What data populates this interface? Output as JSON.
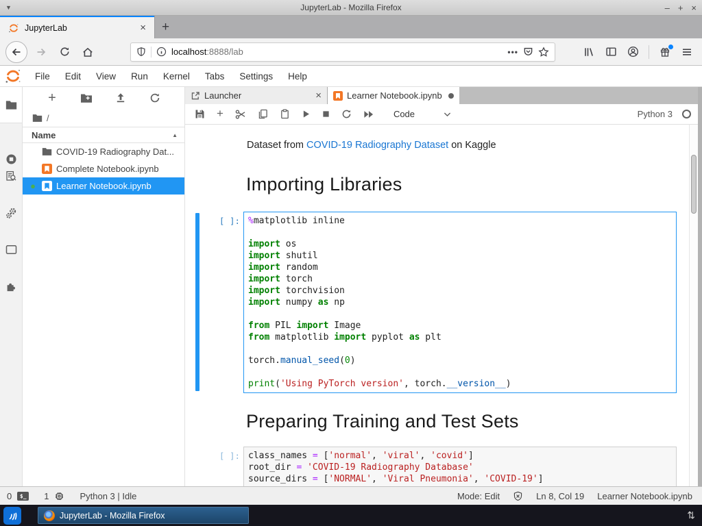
{
  "window": {
    "title": "JupyterLab - Mozilla Firefox",
    "controls": {
      "minimize": "–",
      "maximize": "+",
      "close": "×"
    }
  },
  "browser": {
    "tab_title": "JupyterLab",
    "tab_close": "×",
    "new_tab": "+",
    "url_host": "localhost",
    "url_rest": ":8888/lab"
  },
  "menubar": {
    "items": [
      "File",
      "Edit",
      "View",
      "Run",
      "Kernel",
      "Tabs",
      "Settings",
      "Help"
    ]
  },
  "filebrowser": {
    "breadcrumb": "/",
    "column_header": "Name",
    "sort_arrow": "▲",
    "items": [
      {
        "name": "COVID-19 Radiography Dat...",
        "type": "folder"
      },
      {
        "name": "Complete Notebook.ipynb",
        "type": "notebook"
      },
      {
        "name": "Learner Notebook.ipynb",
        "type": "notebook",
        "selected": true,
        "running_dot": "●"
      }
    ]
  },
  "dock": {
    "tabs": [
      {
        "label": "Launcher",
        "close": "×"
      },
      {
        "label": "Learner Notebook.ipynb",
        "dirty": true
      }
    ],
    "toolbar": {
      "cell_type": "Code",
      "kernel_name": "Python 3"
    }
  },
  "notebook": {
    "markdown_intro": {
      "prefix": "Dataset from ",
      "link": "COVID-19 Radiography Dataset",
      "suffix": " on Kaggle"
    },
    "heading1": "Importing Libraries",
    "heading2": "Preparing Training and Test Sets",
    "cells": [
      {
        "prompt": "[ ]:",
        "lines": [
          [
            [
              "magic",
              "%"
            ],
            [
              "pln",
              "matplotlib inline"
            ]
          ],
          [],
          [
            [
              "kw",
              "import"
            ],
            [
              "pln",
              " os"
            ]
          ],
          [
            [
              "kw",
              "import"
            ],
            [
              "pln",
              " shutil"
            ]
          ],
          [
            [
              "kw",
              "import"
            ],
            [
              "pln",
              " random"
            ]
          ],
          [
            [
              "kw",
              "import"
            ],
            [
              "pln",
              " torch"
            ]
          ],
          [
            [
              "kw",
              "import"
            ],
            [
              "pln",
              " torchvision"
            ]
          ],
          [
            [
              "kw",
              "import"
            ],
            [
              "pln",
              " numpy "
            ],
            [
              "kw",
              "as"
            ],
            [
              "pln",
              " np"
            ]
          ],
          [],
          [
            [
              "kw",
              "from"
            ],
            [
              "pln",
              " PIL "
            ],
            [
              "kw",
              "import"
            ],
            [
              "pln",
              " Image"
            ]
          ],
          [
            [
              "kw",
              "from"
            ],
            [
              "pln",
              " matplotlib "
            ],
            [
              "kw",
              "import"
            ],
            [
              "pln",
              " pyplot "
            ],
            [
              "kw",
              "as"
            ],
            [
              "pln",
              " plt"
            ]
          ],
          [],
          [
            [
              "pln",
              "torch."
            ],
            [
              "prop",
              "manual_seed"
            ],
            [
              "pln",
              "("
            ],
            [
              "num",
              "0"
            ],
            [
              "pln",
              ")"
            ]
          ],
          [],
          [
            [
              "bi",
              "print"
            ],
            [
              "pln",
              "("
            ],
            [
              "str",
              "'Using PyTorch version'"
            ],
            [
              "pln",
              ", torch."
            ],
            [
              "prop",
              "__version__"
            ],
            [
              "pln",
              ")"
            ]
          ]
        ]
      },
      {
        "prompt": "[ ]:",
        "lines": [
          [
            [
              "pln",
              "class_names "
            ],
            [
              "op",
              "="
            ],
            [
              "pln",
              " ["
            ],
            [
              "str",
              "'normal'"
            ],
            [
              "pln",
              ", "
            ],
            [
              "str",
              "'viral'"
            ],
            [
              "pln",
              ", "
            ],
            [
              "str",
              "'covid'"
            ],
            [
              "pln",
              "]"
            ]
          ],
          [
            [
              "pln",
              "root_dir "
            ],
            [
              "op",
              "="
            ],
            [
              "pln",
              " "
            ],
            [
              "str",
              "'COVID-19 Radiography Database'"
            ]
          ],
          [
            [
              "pln",
              "source_dirs "
            ],
            [
              "op",
              "="
            ],
            [
              "pln",
              " ["
            ],
            [
              "str",
              "'NORMAL'"
            ],
            [
              "pln",
              ", "
            ],
            [
              "str",
              "'Viral Pneumonia'"
            ],
            [
              "pln",
              ", "
            ],
            [
              "str",
              "'COVID-19'"
            ],
            [
              "pln",
              "]"
            ]
          ]
        ]
      }
    ]
  },
  "statusbar": {
    "terminals": "0",
    "kernels": "1",
    "kernel_status": "Python 3 | Idle",
    "mode": "Mode: Edit",
    "cursor_position": "Ln 8, Col 19",
    "filename": "Learner Notebook.ipynb"
  },
  "taskbar": {
    "task_label": "JupyterLab - Mozilla Firefox",
    "arrows": "⇅"
  },
  "colors": {
    "accent_blue": "#2196f3",
    "firefox_tab_accent": "#0a84ff",
    "jupyter_orange": "#f37726",
    "selection_green_dot": "#4caf50"
  }
}
